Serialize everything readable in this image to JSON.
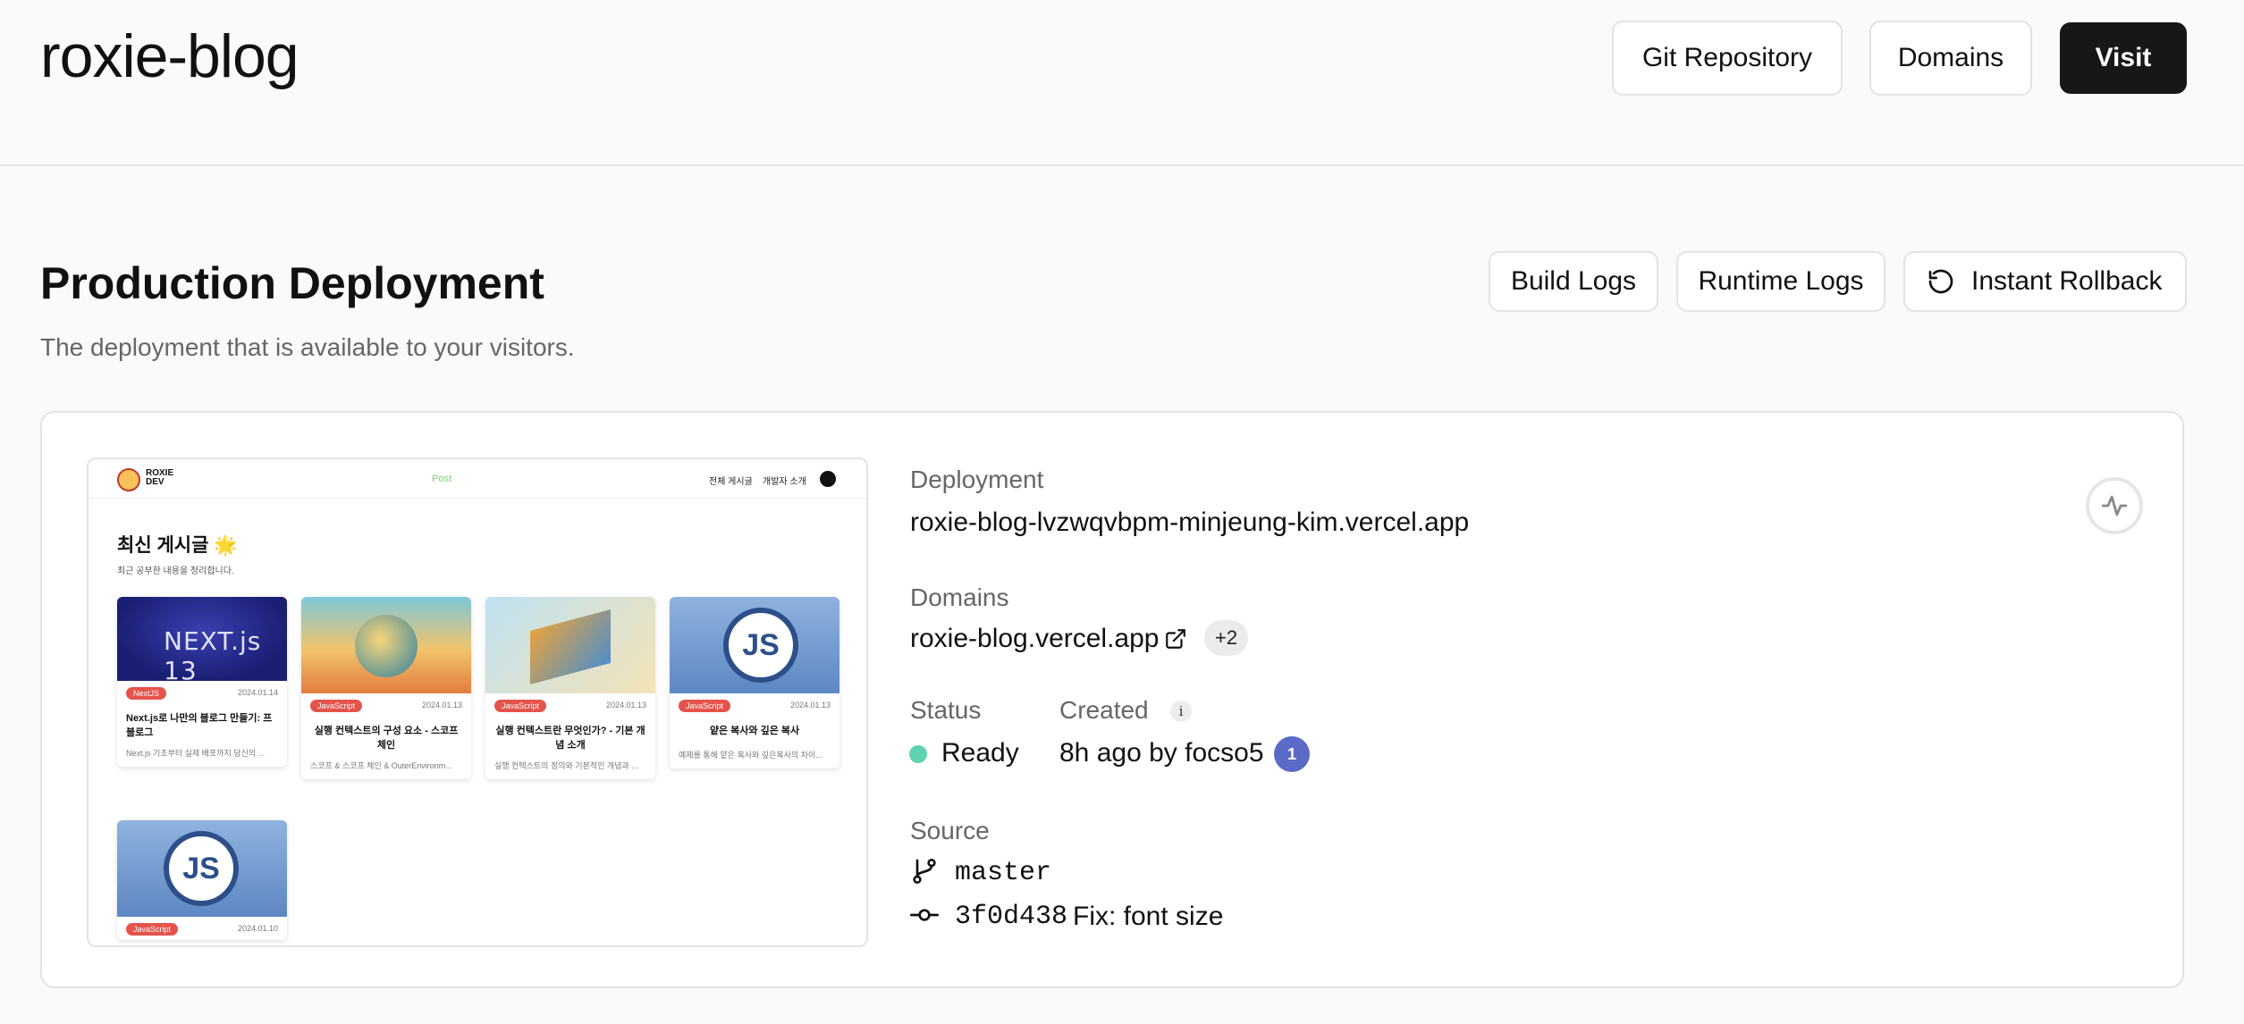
{
  "header": {
    "project_title": "roxie-blog",
    "buttons": {
      "git": "Git Repository",
      "domains": "Domains",
      "visit": "Visit"
    }
  },
  "production": {
    "title": "Production Deployment",
    "subtitle": "The deployment that is available to your visitors.",
    "buttons": {
      "build_logs": "Build Logs",
      "runtime_logs": "Runtime Logs",
      "rollback": "Instant Rollback"
    }
  },
  "preview": {
    "brand": "ROXIE DEV",
    "center_link": "Post",
    "menu": [
      "전체 게시글",
      "개발자 소개"
    ],
    "heading": "최신 게시글 🌟",
    "sub": "최근 공부한 내용을 정리합니다.",
    "cards": [
      {
        "tag": "NextJS",
        "date": "2024.01.14",
        "title": "Next.js로 나만의 블로그 만들기: 프 블로그",
        "desc": "Next.js 기초부터 실제 배포까지 당신의 ...",
        "image_text": "NEXT.js 13"
      },
      {
        "tag": "JavaScript",
        "date": "2024.01.13",
        "title": "실행 컨텍스트의 구성 요소 - 스코프 체인",
        "desc": "스코프 & 스코프 체인 & OuterEnvironm..."
      },
      {
        "tag": "JavaScript",
        "date": "2024.01.13",
        "title": "실행 컨텍스트란 무엇인가? - 기본 개념 소개",
        "desc": "실행 컨텍스트의 정의와 기본적인 개념과 ..."
      },
      {
        "tag": "JavaScript",
        "date": "2024.01.13",
        "title": "얕은 복사와 깊은 복사",
        "desc": "예제를 통해 얕은 복사와 깊은복사의 차이...",
        "image_text": "JS"
      },
      {
        "tag": "JavaScript",
        "date": "2024.01.10",
        "image_text": "JS"
      }
    ]
  },
  "details": {
    "deployment_label": "Deployment",
    "deployment_url": "roxie-blog-lvzwqvbpm-minjeung-kim.vercel.app",
    "domains_label": "Domains",
    "domain": "roxie-blog.vercel.app",
    "domains_more": "+2",
    "status_label": "Status",
    "status": "Ready",
    "created_label": "Created",
    "created": "8h ago by focso5",
    "source_label": "Source",
    "branch": "master",
    "commit_hash": "3f0d438",
    "commit_message": "Fix: font size"
  },
  "colors": {
    "status_ready": "#5fd3b0",
    "visit_button": "#171717",
    "tag": "#e5534b"
  }
}
